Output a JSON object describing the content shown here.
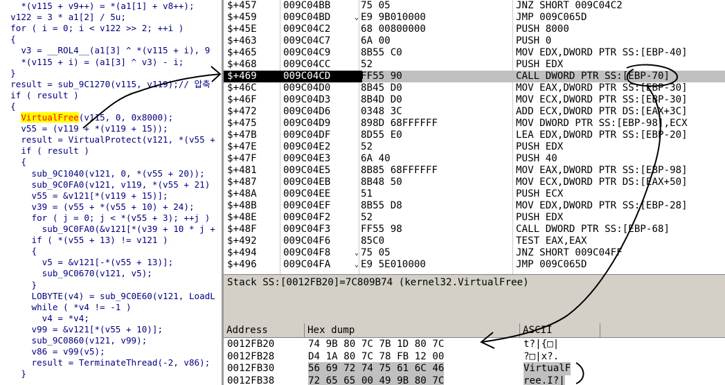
{
  "code_lines": [
    {
      "i": 0,
      "t": "    *(v115 + v9++) = *(a1[1] + v8++);"
    },
    {
      "i": 0,
      "t": "  v122 = 3 * a1[2] / 5u;"
    },
    {
      "i": 0,
      "t": "  for ( i = 0; i < v122 >> 2; ++i )"
    },
    {
      "i": 0,
      "t": "  {"
    },
    {
      "i": 0,
      "t": "    v3 = __ROL4__(a1[3] ^ *(v115 + i), 9"
    },
    {
      "i": 0,
      "t": "    *(v115 + i) = (a1[3] ^ v3) - i;"
    },
    {
      "i": 0,
      "t": "  }"
    },
    {
      "i": 0,
      "t": "  result = sub_9C1270(v115, v119);// 압축"
    },
    {
      "i": 0,
      "t": "  if ( result )"
    },
    {
      "i": 0,
      "t": "  {"
    },
    {
      "i": 0,
      "t": "    ",
      "hl": "VirtualFree",
      "rest": "(v115, 0, 0x8000);"
    },
    {
      "i": 0,
      "t": "    v55 = (v119 + *(v119 + 15));"
    },
    {
      "i": 0,
      "t": "    result = VirtualProtect(v121, *(v55 +"
    },
    {
      "i": 0,
      "t": "    if ( result )"
    },
    {
      "i": 0,
      "t": "    {"
    },
    {
      "i": 0,
      "t": "      sub_9C1040(v121, 0, *(v55 + 20));"
    },
    {
      "i": 0,
      "t": "      sub_9C0FA0(v121, v119, *(v55 + 21)"
    },
    {
      "i": 0,
      "t": "      v55 = &v121[*(v119 + 15)];"
    },
    {
      "i": 0,
      "t": "      v39 = (v55 + *(v55 + 10) + 24);"
    },
    {
      "i": 0,
      "t": "      for ( j = 0; j < *(v55 + 3); ++j )"
    },
    {
      "i": 0,
      "t": "        sub_9C0FA0(&v121[*(v39 + 10 * j +"
    },
    {
      "i": 0,
      "t": "      if ( *(v55 + 13) != v121 )"
    },
    {
      "i": 0,
      "t": "      {"
    },
    {
      "i": 0,
      "t": "        v5 = &v121[-*(v55 + 13)];"
    },
    {
      "i": 0,
      "t": "        sub_9C0670(v121, v5);"
    },
    {
      "i": 0,
      "t": "      }"
    },
    {
      "i": 0,
      "t": "      LOBYTE(v4) = sub_9C0E60(v121, LoadL"
    },
    {
      "i": 0,
      "t": "      while ( *v4 != -1 )"
    },
    {
      "i": 0,
      "t": "        v4 = *v4;"
    },
    {
      "i": 0,
      "t": "      v99 = &v121[*(v55 + 10)];"
    },
    {
      "i": 0,
      "t": "      sub_9C0860(v121, v99);"
    },
    {
      "i": 0,
      "t": "      v86 = v99(v5);"
    },
    {
      "i": 0,
      "t": "      result = TerminateThread(-2, v86);"
    },
    {
      "i": 0,
      "t": "    }"
    }
  ],
  "disasm": [
    {
      "off": "$+457",
      "addr": "009C04BB",
      "hex": "75 05",
      "ins": "JNZ SHORT 009C04C2"
    },
    {
      "off": "$+459",
      "addr": "009C04BD",
      "hex": "E9 9B010000",
      "ins": "JMP 009C065D",
      "mark": "⌄"
    },
    {
      "off": "$+45E",
      "addr": "009C04C2",
      "hex": "68 00800000",
      "ins": "PUSH 8000"
    },
    {
      "off": "$+463",
      "addr": "009C04C7",
      "hex": "6A 00",
      "ins": "PUSH 0"
    },
    {
      "off": "$+465",
      "addr": "009C04C9",
      "hex": "8B55 C0",
      "ins": "MOV EDX,DWORD PTR SS:[EBP-40]"
    },
    {
      "off": "$+468",
      "addr": "009C04CC",
      "hex": "52",
      "ins": "PUSH EDX"
    },
    {
      "off": "$+469",
      "addr": "009C04CD",
      "hex": "FF55 90",
      "ins": "CALL DWORD PTR SS:[EBP-70]",
      "sel": true
    },
    {
      "off": "$+46C",
      "addr": "009C04D0",
      "hex": "8B45 D0",
      "ins": "MOV EAX,DWORD PTR SS:[EBP-30]"
    },
    {
      "off": "$+46F",
      "addr": "009C04D3",
      "hex": "8B4D D0",
      "ins": "MOV ECX,DWORD PTR SS:[EBP-30]"
    },
    {
      "off": "$+472",
      "addr": "009C04D6",
      "hex": "0348 3C",
      "ins": "ADD ECX,DWORD PTR DS:[EAX+3C]"
    },
    {
      "off": "$+475",
      "addr": "009C04D9",
      "hex": "898D 68FFFFFF",
      "ins": "MOV DWORD PTR SS:[EBP-98],ECX"
    },
    {
      "off": "$+47B",
      "addr": "009C04DF",
      "hex": "8D55 E0",
      "ins": "LEA EDX,DWORD PTR SS:[EBP-20]"
    },
    {
      "off": "$+47E",
      "addr": "009C04E2",
      "hex": "52",
      "ins": "PUSH EDX"
    },
    {
      "off": "$+47F",
      "addr": "009C04E3",
      "hex": "6A 40",
      "ins": "PUSH 40"
    },
    {
      "off": "$+481",
      "addr": "009C04E5",
      "hex": "8B85 68FFFFFF",
      "ins": "MOV EAX,DWORD PTR SS:[EBP-98]"
    },
    {
      "off": "$+487",
      "addr": "009C04EB",
      "hex": "8B48 50",
      "ins": "MOV ECX,DWORD PTR DS:[EAX+50]"
    },
    {
      "off": "$+48A",
      "addr": "009C04EE",
      "hex": "51",
      "ins": "PUSH ECX"
    },
    {
      "off": "$+48B",
      "addr": "009C04EF",
      "hex": "8B55 D8",
      "ins": "MOV EDX,DWORD PTR SS:[EBP-28]"
    },
    {
      "off": "$+48E",
      "addr": "009C04F2",
      "hex": "52",
      "ins": "PUSH EDX"
    },
    {
      "off": "$+48F",
      "addr": "009C04F3",
      "hex": "FF55 98",
      "ins": "CALL DWORD PTR SS:[EBP-68]"
    },
    {
      "off": "$+492",
      "addr": "009C04F6",
      "hex": "85C0",
      "ins": "TEST EAX,EAX"
    },
    {
      "off": "$+494",
      "addr": "009C04F8",
      "hex": "75 05",
      "ins": "JNZ SHORT 009C04FF",
      "mark": "⌄"
    },
    {
      "off": "$+496",
      "addr": "009C04FA",
      "hex": "E9 5E010000",
      "ins": "JMP 009C065D",
      "mark": "⌄"
    }
  ],
  "status_text": "Stack SS:[0012FB20]=7C809B74 (kernel32.VirtualFree)",
  "dump_headers": {
    "address": "Address",
    "hex": "Hex dump",
    "ascii": "ASCII"
  },
  "dump_rows": [
    {
      "addr": "0012FB20",
      "hex": "74 9B 80 7C 7B 1D 80 7C",
      "ascii": "t?|{□|",
      "gray": false
    },
    {
      "addr": "0012FB28",
      "hex": "D4 1A 80 7C 78 FB 12 00",
      "ascii": "?□|x?.",
      "gray": false
    },
    {
      "addr": "0012FB30",
      "hex": "56 69 72 74 75 61 6C 46",
      "ascii": "VirtualF",
      "gray": true
    },
    {
      "addr": "0012FB38",
      "hex": "72 65 65 00 49 9B 80 7C",
      "ascii": "ree.I?|",
      "gray": true
    }
  ],
  "colors": {
    "selected_row": "#000000",
    "highlight": "#ffff00",
    "code_text": "#000080",
    "pane_gray": "#d4d0c8"
  }
}
